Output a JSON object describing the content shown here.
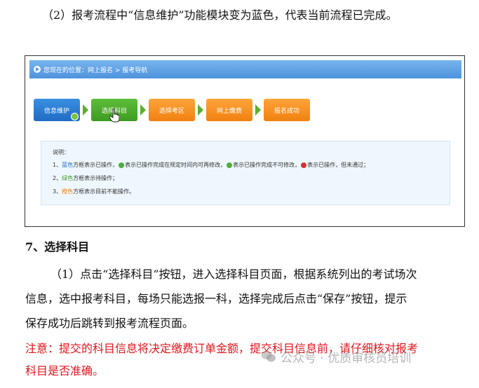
{
  "para1": "（2）报考流程中“信息维护”功能模块变为蓝色，代表当前流程已完成。",
  "figure": {
    "breadcrumb": "您现在的位置：网上报名 > 报考导航",
    "steps": [
      {
        "label": "信息维护",
        "color": "#1f6cc4"
      },
      {
        "label": "选择科目",
        "color": "#3d9b21"
      },
      {
        "label": "选择考区",
        "color": "#f08010"
      },
      {
        "label": "网上缴费",
        "color": "#f08010"
      },
      {
        "label": "报名成功",
        "color": "#f08010"
      }
    ],
    "notes": {
      "title": "说明：",
      "line1_prefix": "1、",
      "line1_blue": "蓝色",
      "line1_a": "方框表示已操作，",
      "line1_b": "表示已操作完成在规定时间内可再修改，",
      "line1_c": "表示已操作完成不可修改，",
      "line1_d": "表示已操作，但未通过；",
      "line2_prefix": "2、",
      "line2_green": "绿色",
      "line2_rest": "方框表示待操作；",
      "line3_prefix": "3、",
      "line3_orange": "橙色",
      "line3_rest": "方框表示目前不能操作。"
    }
  },
  "heading": "7、选择科目",
  "para2_line1": "（1）点击“选择科目”按钮，进入选择科目页面，根据系统列出的考试场次",
  "para2_line2": "信息，选中报考科目，每场只能选报一科，选择完成后点击“保存”按钮，提示",
  "para2_line3": "保存成功后跳转到报考流程页面。",
  "notice_line1": "注意：提交的科目信息将决定缴费订单金额，提交科目信息前，请仔细核对报考",
  "notice_line2": "科目是否准确。",
  "watermark": "公众号 · 优质审核员培训"
}
